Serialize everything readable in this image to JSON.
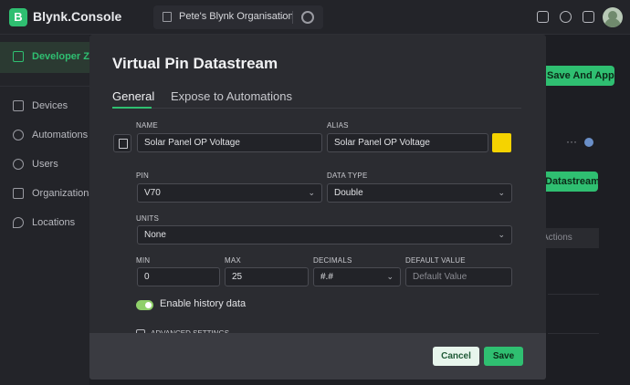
{
  "app": {
    "logo_letter": "B",
    "name": "Blynk.Console"
  },
  "topbar": {
    "org_name": "Pete's Blynk Organisation"
  },
  "sidebar": {
    "items": [
      {
        "label": "Developer Zone",
        "icon": "developer-icon"
      },
      {
        "label": "Devices",
        "icon": "cube-icon"
      },
      {
        "label": "Automations",
        "icon": "sun-icon"
      },
      {
        "label": "Users",
        "icon": "users-icon"
      },
      {
        "label": "Organizations",
        "icon": "building-icon"
      },
      {
        "label": "Locations",
        "icon": "pin-icon"
      }
    ]
  },
  "background": {
    "save_apply": "Save And Apply",
    "datastream_btn": "Datastream",
    "actions_tab": "Actions"
  },
  "modal": {
    "title": "Virtual Pin Datastream",
    "tabs": [
      "General",
      "Expose to Automations"
    ],
    "name": {
      "label": "NAME",
      "value": "Solar Panel OP Voltage"
    },
    "alias": {
      "label": "ALIAS",
      "value": "Solar Panel OP Voltage",
      "color": "#f5d300"
    },
    "pin": {
      "label": "PIN",
      "value": "V70"
    },
    "data_type": {
      "label": "DATA TYPE",
      "value": "Double"
    },
    "units": {
      "label": "UNITS",
      "value": "None"
    },
    "min": {
      "label": "MIN",
      "value": "0"
    },
    "max": {
      "label": "MAX",
      "value": "25"
    },
    "decimals": {
      "label": "DECIMALS",
      "value": "#.#"
    },
    "default_value": {
      "label": "DEFAULT VALUE",
      "placeholder": "Default Value"
    },
    "history": {
      "label": "Enable history data",
      "enabled": true
    },
    "advanced": {
      "label": "ADVANCED SETTINGS"
    },
    "cancel_label": "Cancel",
    "save_label": "Save"
  },
  "colors": {
    "accent": "#2fbf71",
    "alias_color": "#f5d300"
  }
}
